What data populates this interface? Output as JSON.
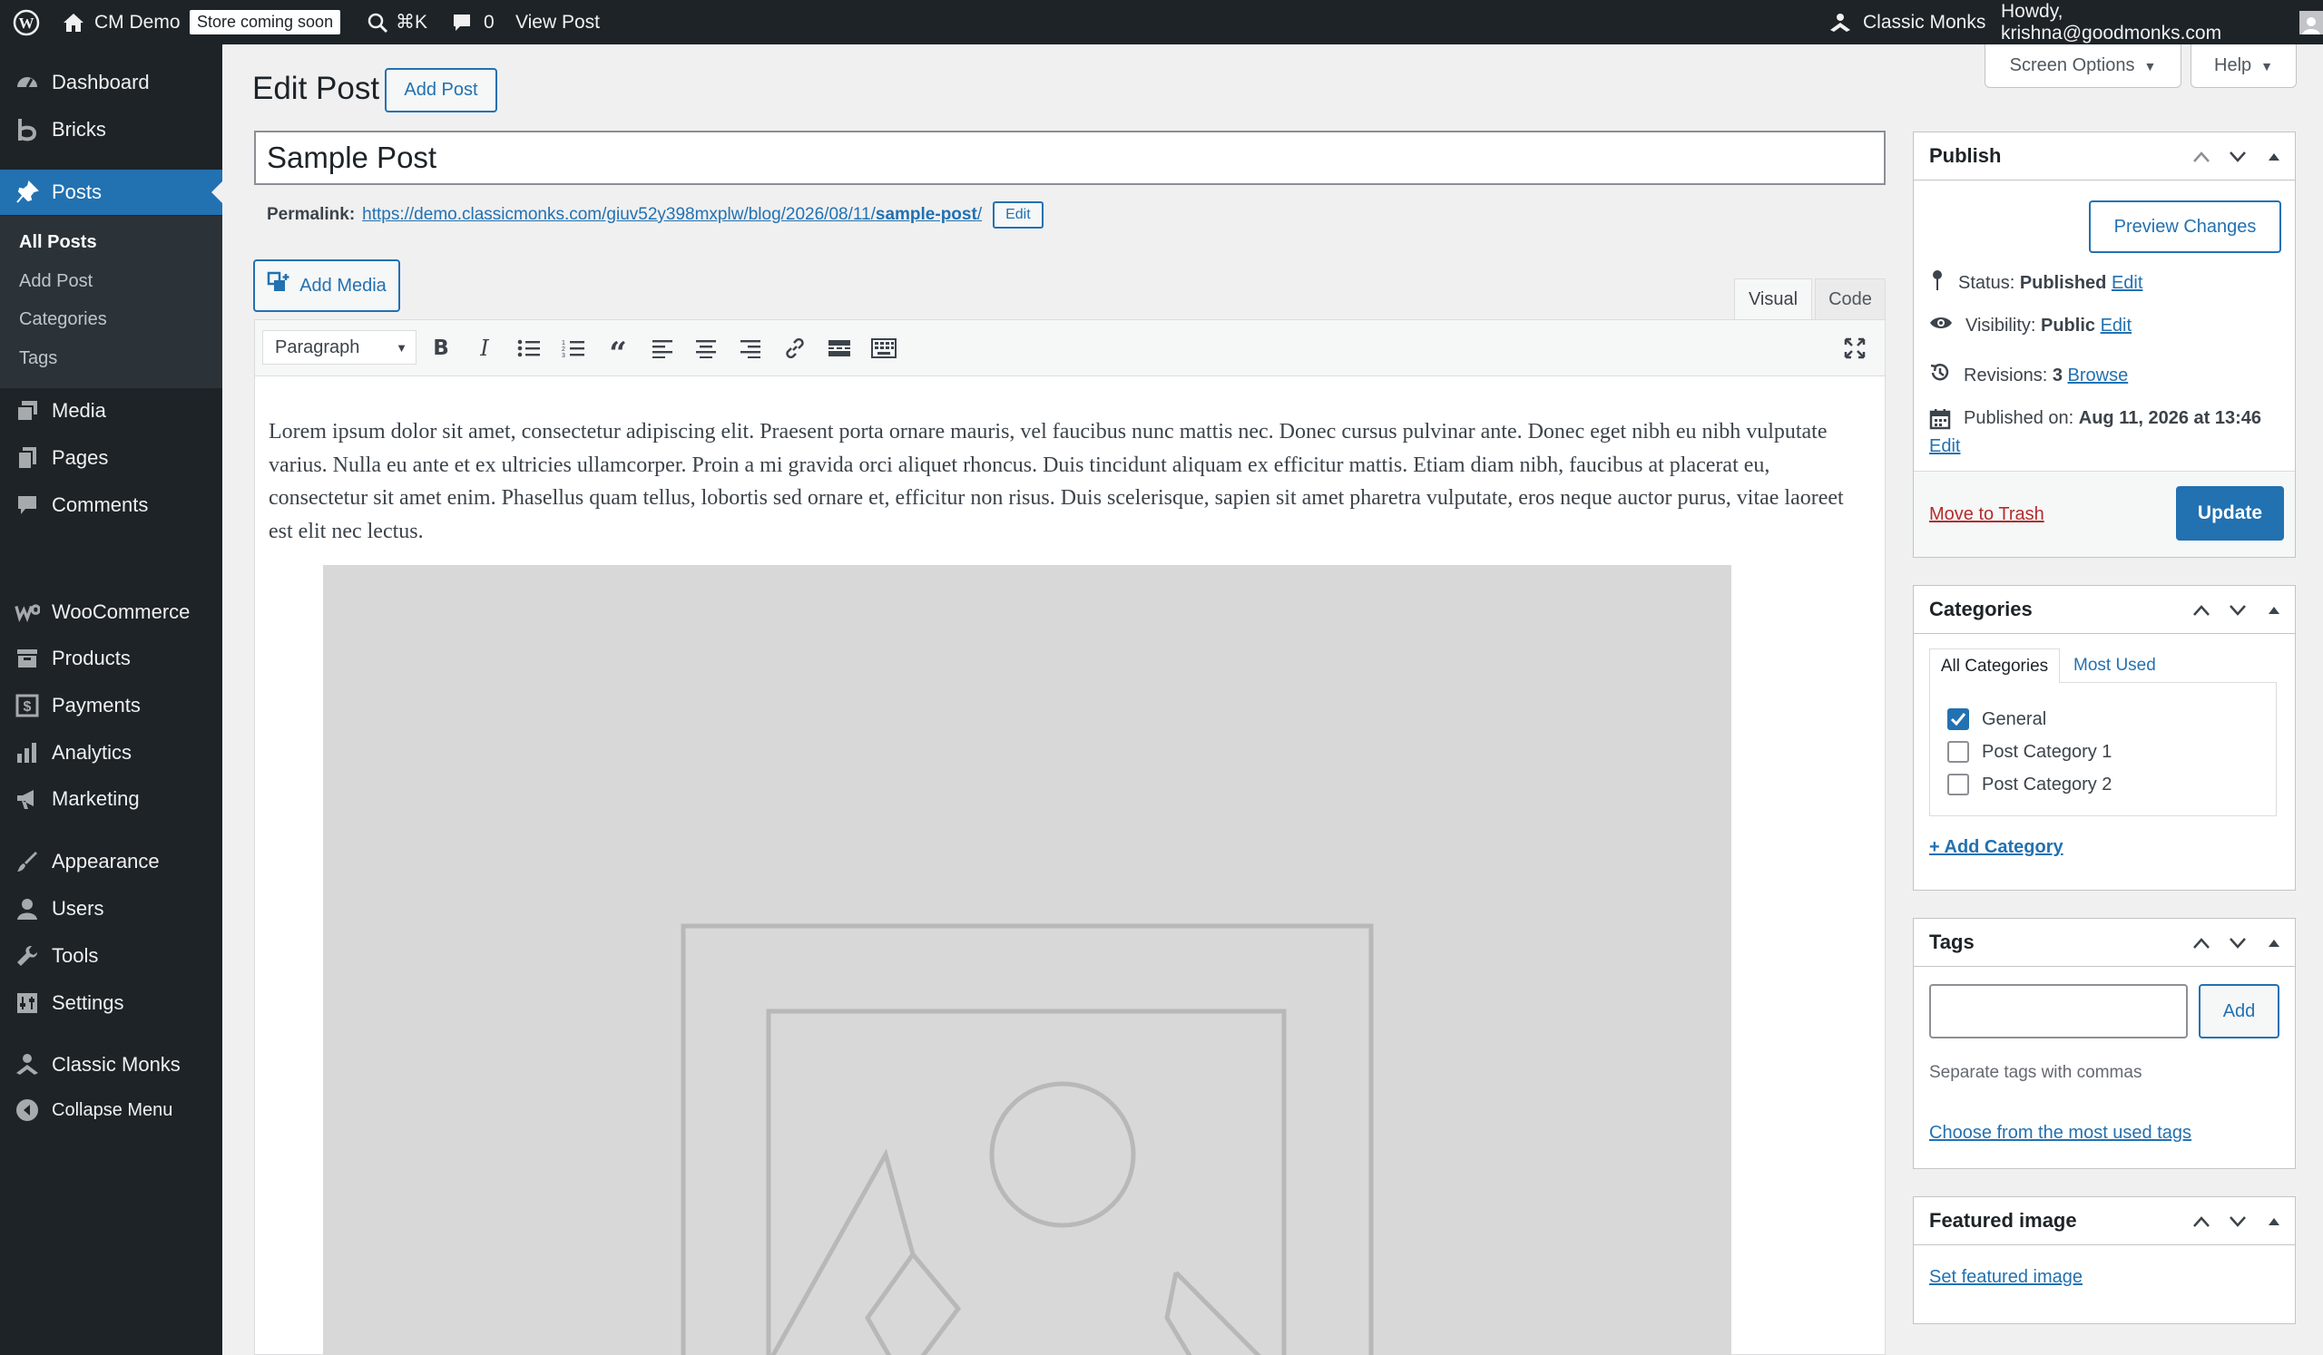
{
  "adminbar": {
    "site_name": "CM Demo",
    "store_badge": "Store coming soon",
    "shortcut": "⌘K",
    "comment_count": "0",
    "view_post": "View Post",
    "brand": "Classic Monks",
    "howdy": "Howdy, krishna@goodmonks.com"
  },
  "sidebar": {
    "items": [
      {
        "label": "Dashboard",
        "icon": "dashboard-icon"
      },
      {
        "label": "Bricks",
        "icon": "bricks-icon"
      },
      {
        "label": "Posts",
        "icon": "pushpin-icon"
      },
      {
        "label": "Media",
        "icon": "media-icon"
      },
      {
        "label": "Pages",
        "icon": "pages-icon"
      },
      {
        "label": "Comments",
        "icon": "comments-icon"
      },
      {
        "label": "WooCommerce",
        "icon": "woocommerce-icon"
      },
      {
        "label": "Products",
        "icon": "products-icon"
      },
      {
        "label": "Payments",
        "icon": "payments-icon"
      },
      {
        "label": "Analytics",
        "icon": "analytics-icon"
      },
      {
        "label": "Marketing",
        "icon": "megaphone-icon"
      },
      {
        "label": "Appearance",
        "icon": "brush-icon"
      },
      {
        "label": "Users",
        "icon": "users-icon"
      },
      {
        "label": "Tools",
        "icon": "wrench-icon"
      },
      {
        "label": "Settings",
        "icon": "settings-icon"
      },
      {
        "label": "Classic Monks",
        "icon": "monk-icon"
      },
      {
        "label": "Collapse Menu",
        "icon": "collapse-icon"
      }
    ],
    "submenu": [
      "All Posts",
      "Add Post",
      "Categories",
      "Tags"
    ]
  },
  "header": {
    "title": "Edit Post",
    "add_post": "Add Post",
    "screen_options": "Screen Options",
    "help": "Help"
  },
  "post": {
    "title": "Sample Post",
    "permalink_label": "Permalink:",
    "permalink_base": "https://demo.classicmonks.com/giuv52y398mxplw/blog/2026/08/11/",
    "permalink_slug": "sample-post",
    "permalink_end": "/",
    "permalink_edit": "Edit"
  },
  "editor": {
    "add_media": "Add Media",
    "tab_visual": "Visual",
    "tab_code": "Code",
    "format": "Paragraph",
    "content": "Lorem ipsum dolor sit amet, consectetur adipiscing elit. Praesent porta ornare mauris, vel faucibus nunc mattis nec. Donec cursus pulvinar ante. Donec eget nibh eu nibh vulputate varius. Nulla eu ante et ex ultricies ullamcorper. Proin a mi gravida orci aliquet rhoncus. Duis tincidunt aliquam ex efficitur mattis. Etiam diam nibh, faucibus at placerat eu, consectetur sit amet enim. Phasellus quam tellus, lobortis sed ornare et, efficitur non risus. Duis scelerisque, sapien sit amet pharetra vulputate, eros neque auctor purus, vitae laoreet est elit nec lectus."
  },
  "publish": {
    "title": "Publish",
    "preview": "Preview Changes",
    "status_label": "Status:",
    "status_value": "Published",
    "visibility_label": "Visibility:",
    "visibility_value": "Public",
    "revisions_label": "Revisions:",
    "revisions_value": "3",
    "browse": "Browse",
    "published_label": "Published on:",
    "published_value": "Aug 11, 2026 at 13:46",
    "edit": "Edit",
    "trash": "Move to Trash",
    "update": "Update"
  },
  "categories": {
    "title": "Categories",
    "tab_all": "All Categories",
    "tab_most": "Most Used",
    "items": [
      {
        "label": "General",
        "checked": true
      },
      {
        "label": "Post Category 1",
        "checked": false
      },
      {
        "label": "Post Category 2",
        "checked": false
      }
    ],
    "add": "+ Add Category"
  },
  "tags": {
    "title": "Tags",
    "input_value": "",
    "add": "Add",
    "hint": "Separate tags with commas",
    "choose": "Choose from the most used tags"
  },
  "featured": {
    "title": "Featured image",
    "set": "Set featured image"
  },
  "colors": {
    "admin_dark": "#1d2327",
    "accent": "#2271b1",
    "trash": "#b32d2e"
  }
}
